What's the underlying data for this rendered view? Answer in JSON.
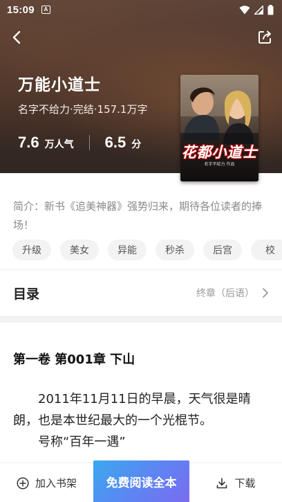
{
  "status_bar": {
    "time": "15:09",
    "app_icon_letter": "A",
    "icons": [
      "wifi-icon",
      "signal-icon",
      "battery-icon"
    ]
  },
  "nav": {
    "back_icon": "back-arrow-icon",
    "share_icon": "share-icon"
  },
  "book": {
    "title": "万能小道士",
    "meta": "名字不给力·完结·157.1万字",
    "popularity_value": "7.6",
    "popularity_unit": "万人气",
    "score_value": "6.5",
    "score_unit": "分",
    "cover_title": "花都小道士",
    "cover_author": "名字不给力 作品"
  },
  "synopsis": "简介：新书《追美神器》强势归来，期待各位读者的捧场！",
  "tags": [
    "升级",
    "美女",
    "异能",
    "秒杀",
    "后宫",
    "校"
  ],
  "toc": {
    "label": "目录",
    "latest": "终章（后语）"
  },
  "chapter": {
    "title": "第一卷 第001章 下山",
    "paragraphs": [
      "2011年11月11日的早晨，天气很是晴朗，也是本世纪最大的一个光棍节。",
      "号称“百年一遇”"
    ]
  },
  "bottom_bar": {
    "add_shelf": "加入书架",
    "read_free": "免费阅读全本",
    "download": "下载"
  },
  "colors": {
    "read_button_start": "#3aa9f0",
    "read_button_end": "#7a6cf0",
    "hero_background": "#4a342a"
  }
}
